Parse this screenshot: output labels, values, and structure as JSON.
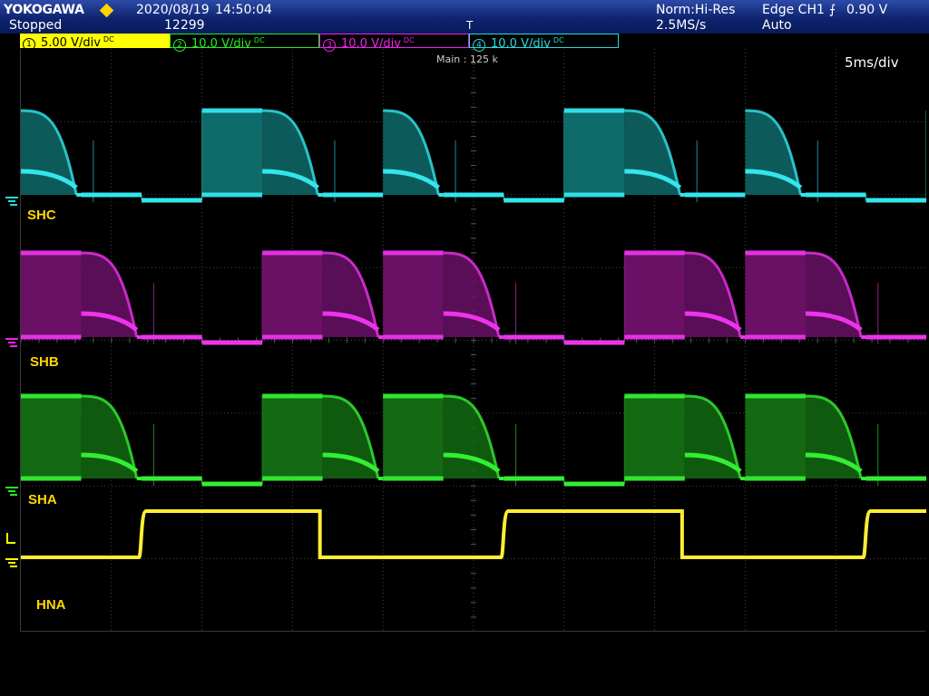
{
  "header": {
    "brand": "YOKOGAWA",
    "state": "Stopped",
    "date": "2020/08/19",
    "time": "14:50:04",
    "acq_count": "12299",
    "acq_mode": "Norm:Hi-Res",
    "sample_rate": "2.5MS/s",
    "trigger": "Edge CH1",
    "trigger_level": "0.90 V",
    "trigger_mode": "Auto",
    "trigger_edge_symbol": "⨍",
    "trigger_pos_symbol": "T"
  },
  "channels": [
    {
      "num": "1",
      "scale": "5.00 V/div",
      "color": "#ffff00",
      "bg": "#ffff00",
      "fg": "#000000"
    },
    {
      "num": "2",
      "scale": "10.0 V/div",
      "color": "#22ee22",
      "bg": "#000000",
      "fg": "#22ee22"
    },
    {
      "num": "3",
      "scale": "10.0 V/div",
      "color": "#ee22ee",
      "bg": "#000000",
      "fg": "#ee22ee"
    },
    {
      "num": "4",
      "scale": "10.0 V/div",
      "color": "#22dddd",
      "bg": "#000000",
      "fg": "#22dddd"
    }
  ],
  "screen": {
    "main_record": "Main : 125 k",
    "timebase": "5ms/div"
  },
  "trace_labels": {
    "shc": "SHC",
    "shb": "SHB",
    "sha": "SHA",
    "hna": "HNA"
  },
  "waveforms": {
    "period_div": 4,
    "sections_per_period": 6,
    "shc_pattern": [
      "decay",
      "low",
      "dip",
      "high",
      "decay",
      "low"
    ],
    "shb_pattern": [
      "high",
      "decay",
      "low",
      "dip",
      "high",
      "decay"
    ],
    "sha_pattern": [
      "high",
      "decay",
      "low",
      "dip",
      "high",
      "decay"
    ],
    "colors": {
      "shc": {
        "line": "#33e6ee",
        "fill": "#0f6a6a"
      },
      "shb": {
        "line": "#ee33ee",
        "fill": "#6a1166"
      },
      "sha": {
        "line": "#33ee33",
        "fill": "#136a13"
      },
      "hna": {
        "line": "#ffee33"
      }
    }
  }
}
